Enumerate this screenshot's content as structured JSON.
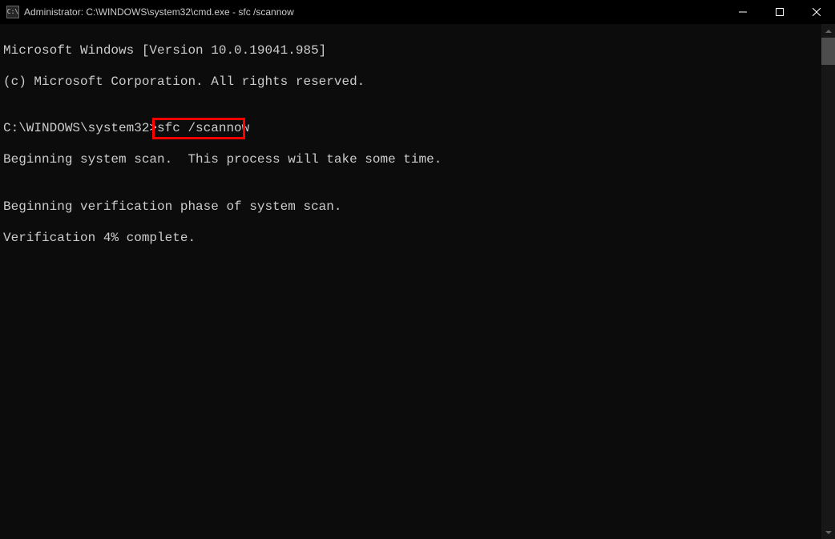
{
  "window": {
    "title": "Administrator: C:\\WINDOWS\\system32\\cmd.exe - sfc  /scannow",
    "iconGlyph": "C:\\"
  },
  "terminal": {
    "line1": "Microsoft Windows [Version 10.0.19041.985]",
    "line2": "(c) Microsoft Corporation. All rights reserved.",
    "blank1": "",
    "prompt": "C:\\WINDOWS\\system32>",
    "command": "sfc /scannow",
    "blank2": "",
    "line4": "Beginning system scan.  This process will take some time.",
    "blank3": "",
    "line5": "Beginning verification phase of system scan.",
    "line6": "Verification 4% complete."
  }
}
